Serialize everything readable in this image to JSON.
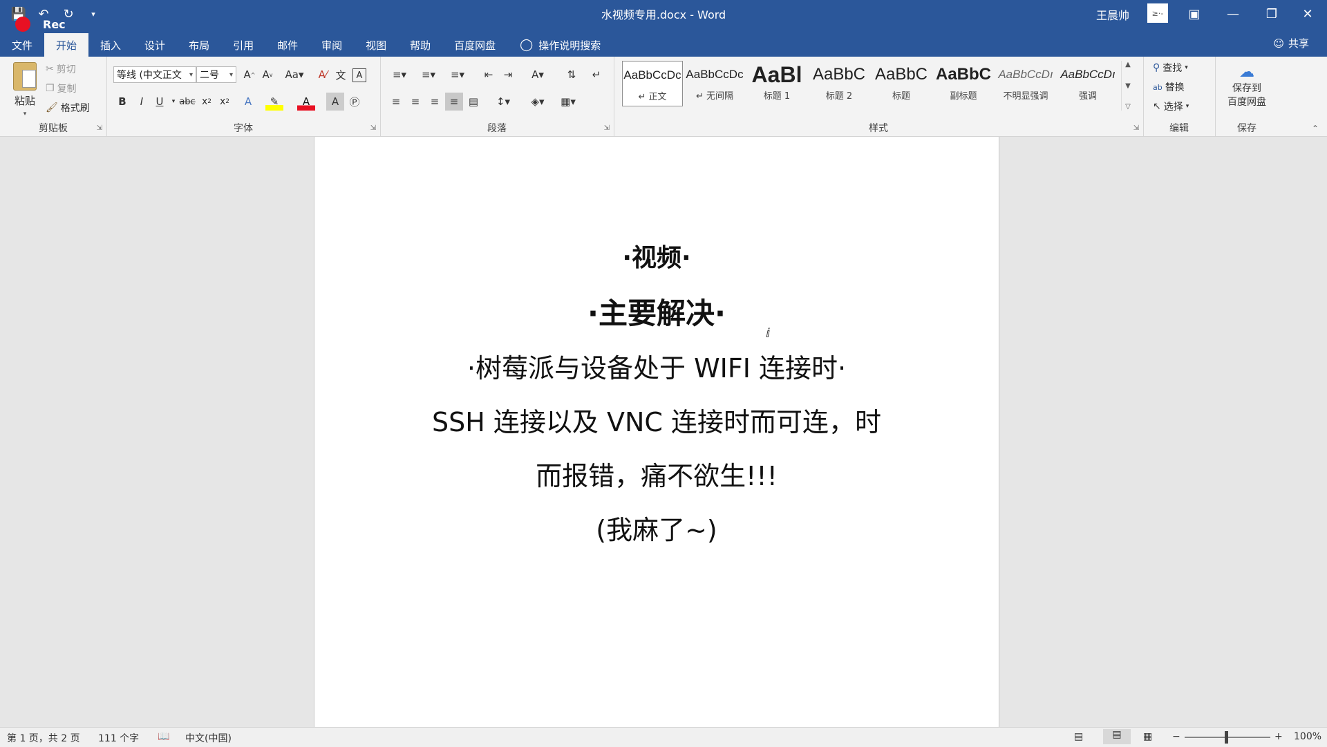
{
  "window": {
    "title": "水视频专用.docx  -  Word",
    "user": "王晨帅",
    "avatar_text": "≥·-",
    "rec_label": "Rec"
  },
  "tabs": [
    {
      "label": "文件"
    },
    {
      "label": "开始"
    },
    {
      "label": "插入"
    },
    {
      "label": "设计"
    },
    {
      "label": "布局"
    },
    {
      "label": "引用"
    },
    {
      "label": "邮件"
    },
    {
      "label": "审阅"
    },
    {
      "label": "视图"
    },
    {
      "label": "帮助"
    },
    {
      "label": "百度网盘"
    }
  ],
  "tell_me": "操作说明搜索",
  "share": "共享",
  "clipboard": {
    "paste": "粘贴",
    "cut": "剪切",
    "copy": "复制",
    "format_painter": "格式刷",
    "label": "剪贴板"
  },
  "font": {
    "font_name": "等线 (中文正文",
    "font_size": "二号",
    "label": "字体"
  },
  "paragraph": {
    "label": "段落"
  },
  "styles": {
    "label": "样式",
    "items": [
      {
        "sample": "AaBbCcDc",
        "name": "↵ 正文"
      },
      {
        "sample": "AaBbCcDc",
        "name": "↵ 无间隔"
      },
      {
        "sample": "AaBl",
        "name": "标题 1"
      },
      {
        "sample": "AaBbC",
        "name": "标题 2"
      },
      {
        "sample": "AaBbC",
        "name": "标题"
      },
      {
        "sample": "AaBbC",
        "name": "副标题"
      },
      {
        "sample": "AaBbCcDı",
        "name": "不明显强调"
      },
      {
        "sample": "AaBbCcDı",
        "name": "强调"
      }
    ]
  },
  "editing": {
    "find": "查找",
    "replace": "替换",
    "select": "选择",
    "label": "编辑"
  },
  "save_group": {
    "button_line1": "保存到",
    "button_line2": "百度网盘",
    "label": "保存"
  },
  "document": {
    "lines": [
      "·视频·",
      "·主要解决·",
      "·树莓派与设备处于 WIFI 连接时·",
      "SSH 连接以及 VNC 连接时而可连，时",
      "而报错，痛不欲生!!!",
      "(我麻了~)"
    ]
  },
  "status": {
    "page": "第 1 页，共 2 页",
    "words": "111 个字",
    "language": "中文(中国)",
    "zoom": "100%"
  }
}
